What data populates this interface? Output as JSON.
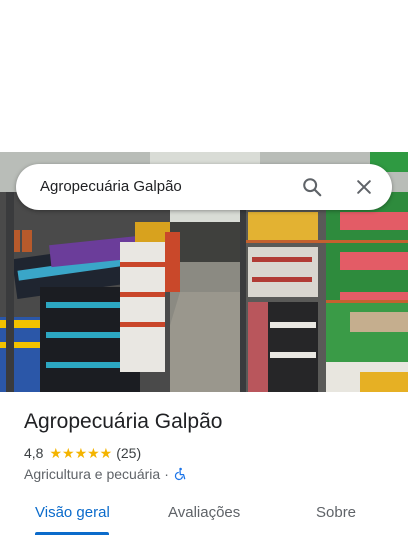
{
  "search": {
    "query": "Agropecuária Galpão"
  },
  "place": {
    "name": "Agropecuária Galpão",
    "rating": "4,8",
    "stars": "★★★★★",
    "rating_value": 4.8,
    "review_count": "(25)",
    "category": "Agricultura e pecuária",
    "separator": "·"
  },
  "tabs": [
    {
      "label": "Visão geral",
      "active": true
    },
    {
      "label": "Avaliações",
      "active": false
    },
    {
      "label": "Sobre",
      "active": false
    }
  ],
  "icons": {
    "search": "search-icon",
    "close": "close-icon",
    "accessibility": "wheelchair-icon"
  },
  "colors": {
    "accent": "#0b6bcb",
    "stars": "#f4b400",
    "accessibility": "#1a73e8"
  }
}
